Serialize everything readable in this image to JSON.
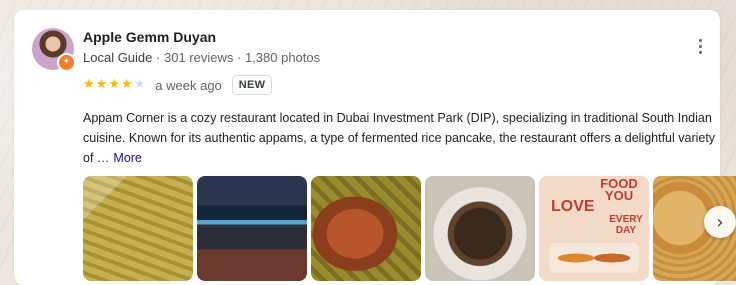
{
  "reviewer": {
    "name": "Apple Gemm Duyan",
    "guide_label": "Local Guide",
    "reviews": "301 reviews",
    "photos": "1,380 photos",
    "separator": "·"
  },
  "review": {
    "rating": 4,
    "max_rating": 5,
    "time": "a week ago",
    "badge": "NEW",
    "text": "Appam Corner is a cozy restaurant located in Dubai Investment Park (DIP), specializing in traditional South Indian cuisine. Known for its authentic appams, a type of fermented rice pancake, the restaurant offers a delightful variety of …",
    "more_label": "More"
  },
  "photo_5": {
    "food_text": "FOOD YOU",
    "love_text": "LOVE",
    "every_text": "EVERY DAY"
  },
  "icons": {
    "menu": "more-vert-icon",
    "next": "chevron-right-icon",
    "star_filled": "★",
    "star_empty": "★",
    "chevron": "›"
  },
  "colors": {
    "star": "#fbbc04",
    "link": "#1a0dab",
    "badge_orange": "#f57c2b"
  }
}
